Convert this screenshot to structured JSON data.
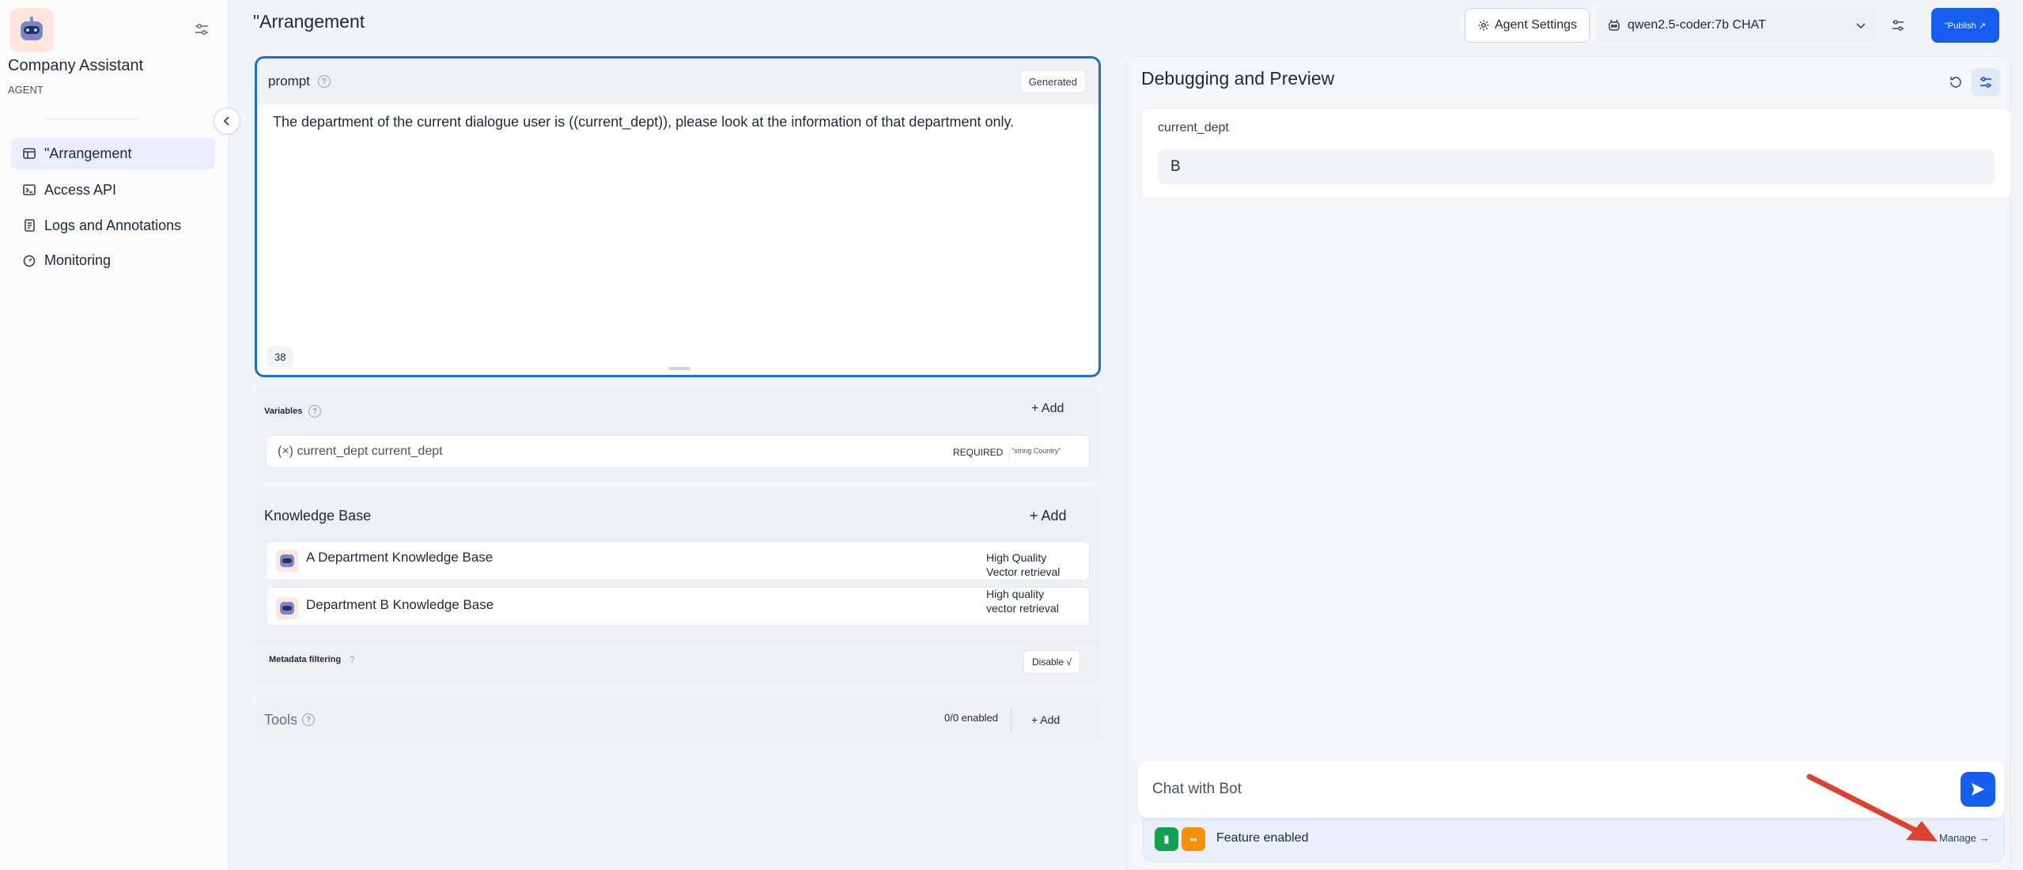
{
  "app": {
    "name": "Company Assistant",
    "type": "AGENT"
  },
  "sidebar": {
    "items": [
      {
        "label": "\"Arrangement",
        "icon": "layout-icon",
        "active": true
      },
      {
        "label": "Access API",
        "icon": "terminal-icon",
        "active": false
      },
      {
        "label": "Logs and Annotations",
        "icon": "document-icon",
        "active": false
      },
      {
        "label": "Monitoring",
        "icon": "gauge-icon",
        "active": false
      }
    ]
  },
  "header": {
    "title": "\"Arrangement",
    "agent_settings_label": "Agent Settings",
    "model_label": "qwen2.5-coder:7b CHAT",
    "publish_label": "\"Publish ↗"
  },
  "prompt": {
    "label": "prompt",
    "generated_label": "Generated",
    "text": "The department of the current dialogue user is ((current_dept)), please look at the information of that department only.",
    "char_count": "38"
  },
  "variables": {
    "label": "Variables",
    "add_label": "+ Add",
    "items": [
      {
        "key_text": "(×) current_dept current_dept",
        "required_label": "REQUIRED",
        "type_text": "\"string Country\""
      }
    ]
  },
  "knowledge_base": {
    "label": "Knowledge Base",
    "add_label": "+ Add",
    "items": [
      {
        "name": "A Department Knowledge Base",
        "meta_line1": "High Quality",
        "meta_line2": "Vector retrieval"
      },
      {
        "name": "Department B Knowledge Base",
        "meta_line1": "High quality",
        "meta_line2": "vector retrieval"
      }
    ],
    "metadata_filtering_label": "Metadata filtering",
    "disable_label": "Disable √"
  },
  "tools": {
    "label": "Tools",
    "enabled_count": "0/0 enabled",
    "add_label": "+ Add"
  },
  "debug": {
    "title": "Debugging and Preview",
    "variable_name": "current_dept",
    "variable_value": "B",
    "chat_placeholder": "Chat with Bot",
    "feature_label": "Feature enabled",
    "manage_label": "Manage →"
  },
  "colors": {
    "accent": "#155eef",
    "prompt_border": "#1a6fd6",
    "annotation_arrow": "#d9432f"
  }
}
